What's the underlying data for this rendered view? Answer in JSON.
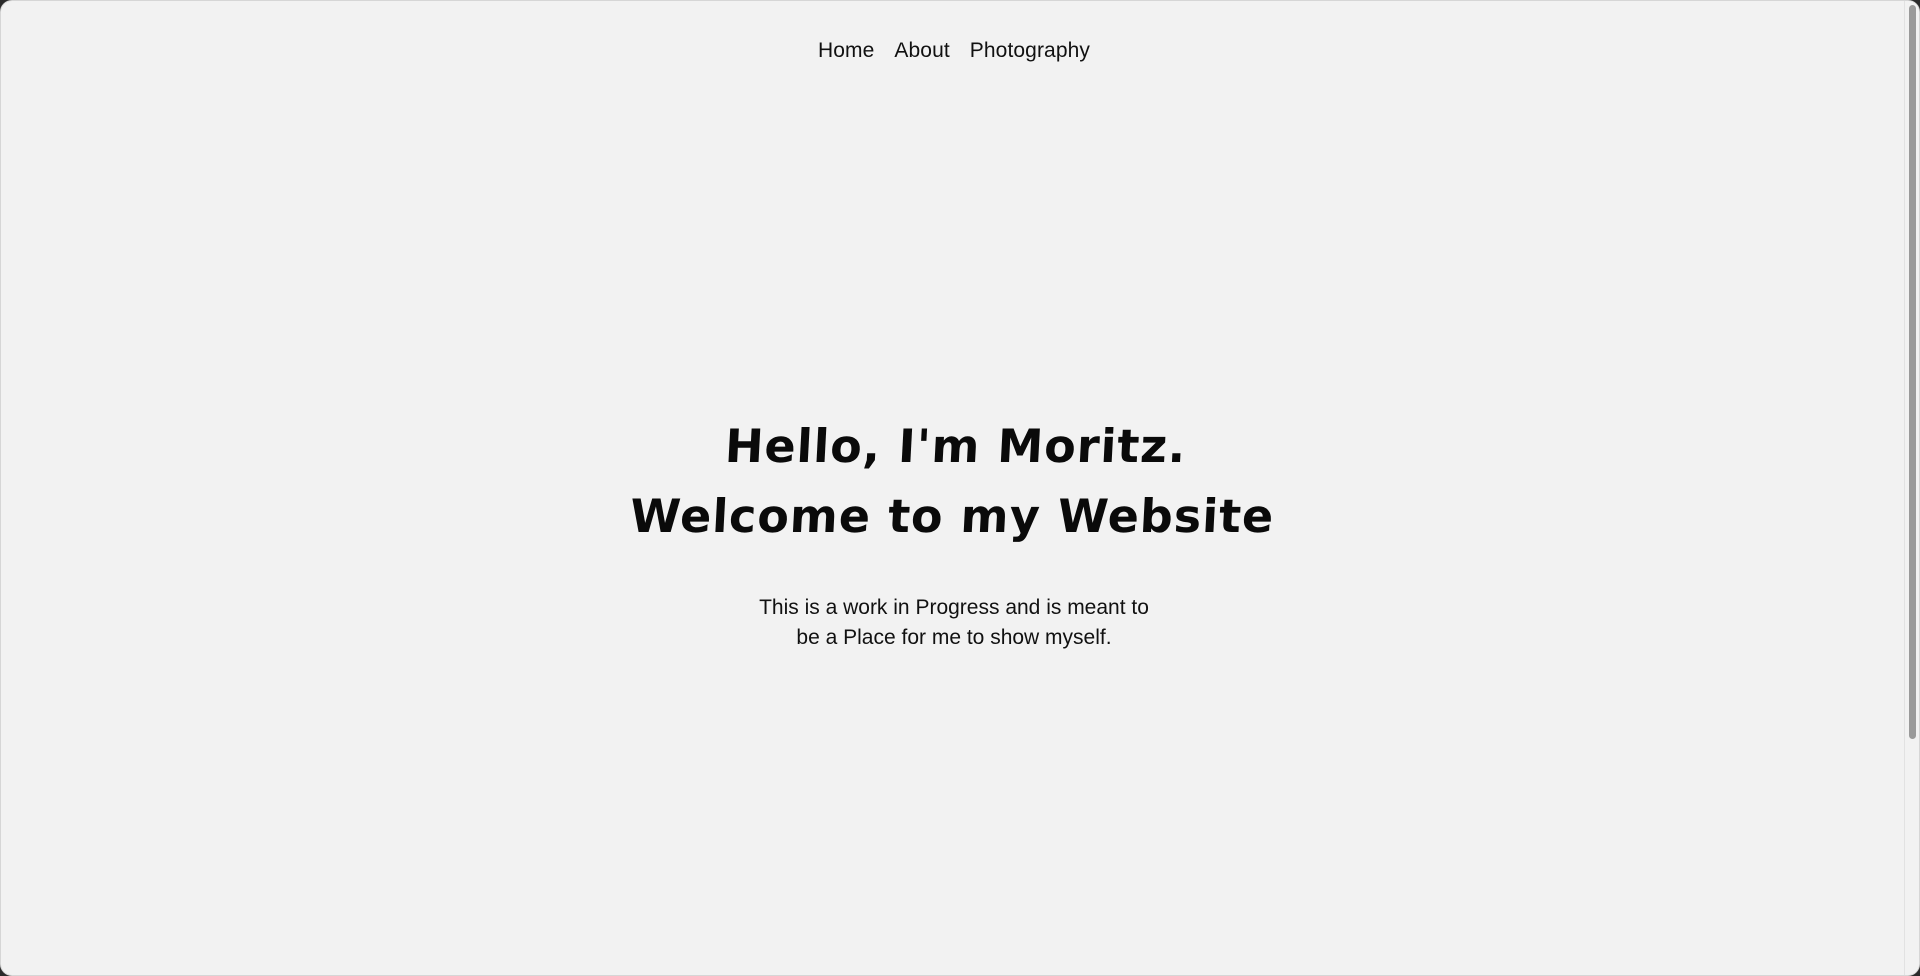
{
  "nav": {
    "items": [
      {
        "label": "Home"
      },
      {
        "label": "About"
      },
      {
        "label": "Photography"
      }
    ]
  },
  "hero": {
    "line1": "Hello, I'm Moritz.",
    "line2": "Welcome to my Website",
    "subtext_line1": "This is a work in Progress and is meant to",
    "subtext_line2": "be a Place for me to show myself."
  },
  "colors": {
    "background": "#f2f2f2",
    "text": "#111111"
  }
}
